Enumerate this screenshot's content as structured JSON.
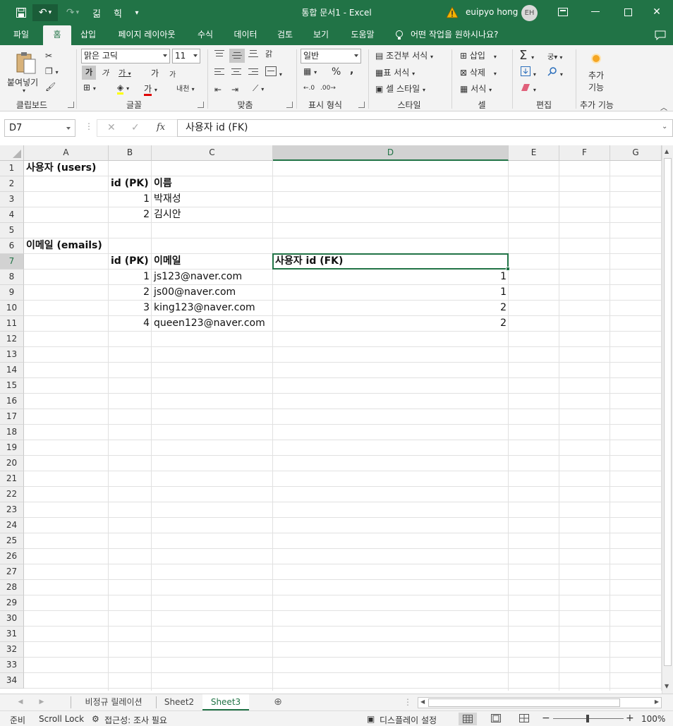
{
  "titlebar": {
    "title": "통합 문서1  -  Excel",
    "user": "euipyo hong",
    "avatar_initials": "EH",
    "undo_icon": "undo-icon",
    "redo_icon": "redo-icon"
  },
  "tabs": [
    "파일",
    "홈",
    "삽입",
    "페이지 레이아웃",
    "수식",
    "데이터",
    "검토",
    "보기",
    "도움말"
  ],
  "tell_me": "어떤 작업을 원하시나요?",
  "ribbon": {
    "clipboard": {
      "paste": "붙여넣기",
      "label": "클립보드"
    },
    "font": {
      "name": "맑은 고딕",
      "size": "11",
      "label": "글꼴",
      "bold": "가",
      "italic": "가",
      "underline": "가",
      "grow": "가",
      "shrink": "가",
      "color": "가",
      "phonetic": "내천"
    },
    "align": {
      "label": "맞춤",
      "wrap": "갉"
    },
    "number": {
      "format": "일반",
      "label": "표시 형식",
      "percent": "%",
      "comma": ","
    },
    "styles": {
      "conditional": "조건부 서식",
      "table": "표 서식",
      "cell": "셀 스타일",
      "label": "스타일"
    },
    "cells": {
      "insert": "삽입",
      "delete": "삭제",
      "format": "서식",
      "label": "셀"
    },
    "editing": {
      "label": "편집"
    },
    "addins": {
      "button_line1": "추가",
      "button_line2": "기능",
      "label": "추가 기능"
    }
  },
  "formula_bar": {
    "name_box": "D7",
    "fx": "fx",
    "formula": "사용자 id (FK)"
  },
  "sheet": {
    "columns": [
      "A",
      "B",
      "C",
      "D",
      "E",
      "F",
      "G"
    ],
    "selected_column": "D",
    "selected_row": "7",
    "rows": [
      "1",
      "2",
      "3",
      "4",
      "5",
      "6",
      "7",
      "8",
      "9",
      "10",
      "11",
      "12",
      "13",
      "14",
      "15",
      "16",
      "17",
      "18",
      "19",
      "20",
      "21",
      "22",
      "23",
      "24",
      "25",
      "26",
      "27",
      "28",
      "29",
      "30",
      "31",
      "32",
      "33",
      "34"
    ],
    "cells": {
      "A1": "사용자 (users)",
      "B2": "id (PK)",
      "C2": "이름",
      "B3": "1",
      "C3": "박재성",
      "B4": "2",
      "C4": "김시안",
      "A6": "이메일 (emails)",
      "B7": "id (PK)",
      "C7": "이메일",
      "D7": "사용자 id (FK)",
      "B8": "1",
      "C8": "js123@naver.com",
      "D8": "1",
      "B9": "2",
      "C9": "js00@naver.com",
      "D9": "1",
      "B10": "3",
      "C10": "king123@naver.com",
      "D10": "2",
      "B11": "4",
      "C11": "queen123@naver.com",
      "D11": "2"
    }
  },
  "sheet_tabs": [
    "비정규 릴레이션",
    "Sheet2",
    "Sheet3"
  ],
  "active_sheet": "Sheet3",
  "status": {
    "ready": "준비",
    "scroll_lock": "Scroll Lock",
    "accessibility": "접근성: 조사 필요",
    "display": "디스플레이 설정",
    "zoom": "100%"
  },
  "colors": {
    "accent": "#217346"
  }
}
